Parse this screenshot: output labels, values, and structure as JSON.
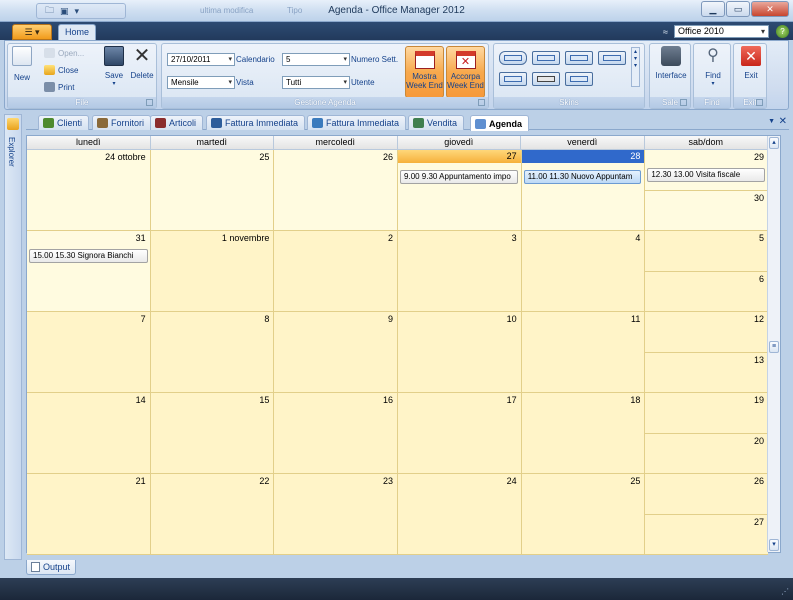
{
  "window": {
    "title": "Agenda - Office Manager 2012",
    "qat_items": [
      "File",
      "Save"
    ],
    "ghost_texts": [
      "ultima modifica",
      "Tipo"
    ]
  },
  "tabs": {
    "app_button": "☰ ▾",
    "home": "Home"
  },
  "skin_picker": {
    "value": "Office 2010"
  },
  "ribbon": {
    "file_group": {
      "label": "File",
      "new": "New",
      "open": "Open...",
      "close": "Close",
      "print": "Print",
      "save": "Save",
      "delete": "Delete"
    },
    "agenda_group": {
      "label": "Gestione Agenda",
      "date_value": "27/10/2011",
      "date_label": "Calendario",
      "week_count_value": "5",
      "week_count_label": "Numero Sett.",
      "view_value": "Mensile",
      "view_label": "Vista",
      "user_value": "Tutti",
      "user_label": "Utente",
      "show_weekend_line1": "Mostra",
      "show_weekend_line2": "Week End",
      "merge_weekend_line1": "Accorpa",
      "merge_weekend_line2": "Week End"
    },
    "skins_group": {
      "label": "Skins"
    },
    "sale_group": {
      "label": "Sale",
      "interface": "Interface"
    },
    "find_group": {
      "label": "Find",
      "find": "Find"
    },
    "exit_group": {
      "label": "Exit",
      "exit": "Exit"
    }
  },
  "explorer": {
    "label": "Explorer"
  },
  "doc_tabs": [
    {
      "label": "Clienti",
      "icon": "clients-icon",
      "color": "#4e8a2e"
    },
    {
      "label": "Fornitori",
      "icon": "suppliers-icon",
      "color": "#8a6a3a"
    },
    {
      "label": "Articoli",
      "icon": "articles-icon",
      "color": "#8b2d2d"
    },
    {
      "label": "Fattura Immediata",
      "icon": "invoice-icon",
      "color": "#2d5d9a"
    },
    {
      "label": "Fattura Immediata",
      "icon": "invoice-icon",
      "color": "#3b7bbd"
    },
    {
      "label": "Vendita",
      "icon": "sale-icon",
      "color": "#3f7f4f"
    },
    {
      "label": "Agenda",
      "icon": "agenda-icon",
      "color": "#5f8fd0"
    }
  ],
  "calendar": {
    "headers": [
      "lunedì",
      "martedì",
      "mercoledì",
      "giovedì",
      "venerdì",
      "sab/dom"
    ],
    "weeks": [
      {
        "days": [
          "24 ottobre",
          "25",
          "26",
          "27",
          "28"
        ],
        "sat": "29",
        "sun": "30",
        "appointments": {
          "thu": "9.00  9.30  Appuntamento impo",
          "fri": "11.00  11.30  Nuovo Appuntam",
          "sat": "12.30  13.00  Visita fiscale"
        }
      },
      {
        "days": [
          "31",
          "1 novembre",
          "2",
          "3",
          "4"
        ],
        "sat": "5",
        "sun": "6",
        "appointments": {
          "mon": "15.00  15.30  Signora Bianchi"
        }
      },
      {
        "days": [
          "7",
          "8",
          "9",
          "10",
          "11"
        ],
        "sat": "12",
        "sun": "13"
      },
      {
        "days": [
          "14",
          "15",
          "16",
          "17",
          "18"
        ],
        "sat": "19",
        "sun": "20"
      },
      {
        "days": [
          "21",
          "22",
          "23",
          "24",
          "25"
        ],
        "sat": "26",
        "sun": "27"
      }
    ]
  },
  "output": {
    "label": "Output"
  },
  "colors": {
    "accent_orange": "#f6993a",
    "selected_blue": "#3069cb",
    "calendar_cell": "#fff4c8"
  }
}
